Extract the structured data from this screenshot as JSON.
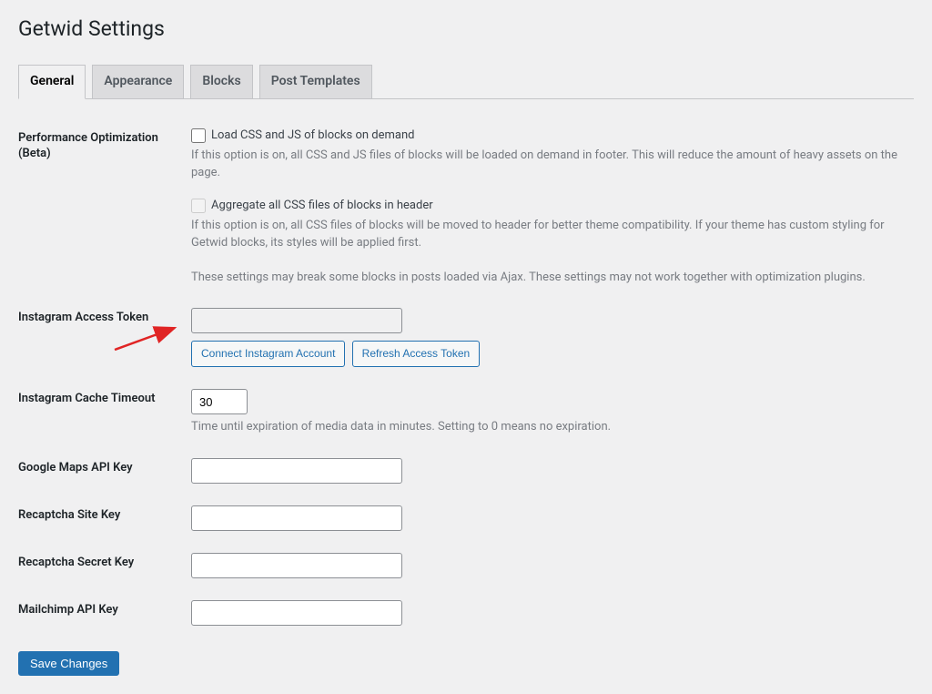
{
  "page_title": "Getwid Settings",
  "tabs": [
    {
      "label": "General",
      "active": true
    },
    {
      "label": "Appearance",
      "active": false
    },
    {
      "label": "Blocks",
      "active": false
    },
    {
      "label": "Post Templates",
      "active": false
    }
  ],
  "performance": {
    "heading": "Performance Optimization (Beta)",
    "load_on_demand_label": "Load CSS and JS of blocks on demand",
    "load_on_demand_desc": "If this option is on, all CSS and JS files of blocks will be loaded on demand in footer. This will reduce the amount of heavy assets on the page.",
    "aggregate_label": "Aggregate all CSS files of blocks in header",
    "aggregate_desc": "If this option is on, all CSS files of blocks will be moved to header for better theme compatibility. If your theme has custom styling for Getwid blocks, its styles will be applied first.",
    "warning": "These settings may break some blocks in posts loaded via Ajax. These settings may not work together with optimization plugins."
  },
  "instagram_token": {
    "heading": "Instagram Access Token",
    "value": "",
    "connect_label": "Connect Instagram Account",
    "refresh_label": "Refresh Access Token"
  },
  "instagram_cache": {
    "heading": "Instagram Cache Timeout",
    "value": "30",
    "desc": "Time until expiration of media data in minutes. Setting to 0 means no expiration."
  },
  "google_maps": {
    "heading": "Google Maps API Key",
    "value": ""
  },
  "recaptcha_site": {
    "heading": "Recaptcha Site Key",
    "value": ""
  },
  "recaptcha_secret": {
    "heading": "Recaptcha Secret Key",
    "value": ""
  },
  "mailchimp": {
    "heading": "Mailchimp API Key",
    "value": ""
  },
  "save_label": "Save Changes"
}
